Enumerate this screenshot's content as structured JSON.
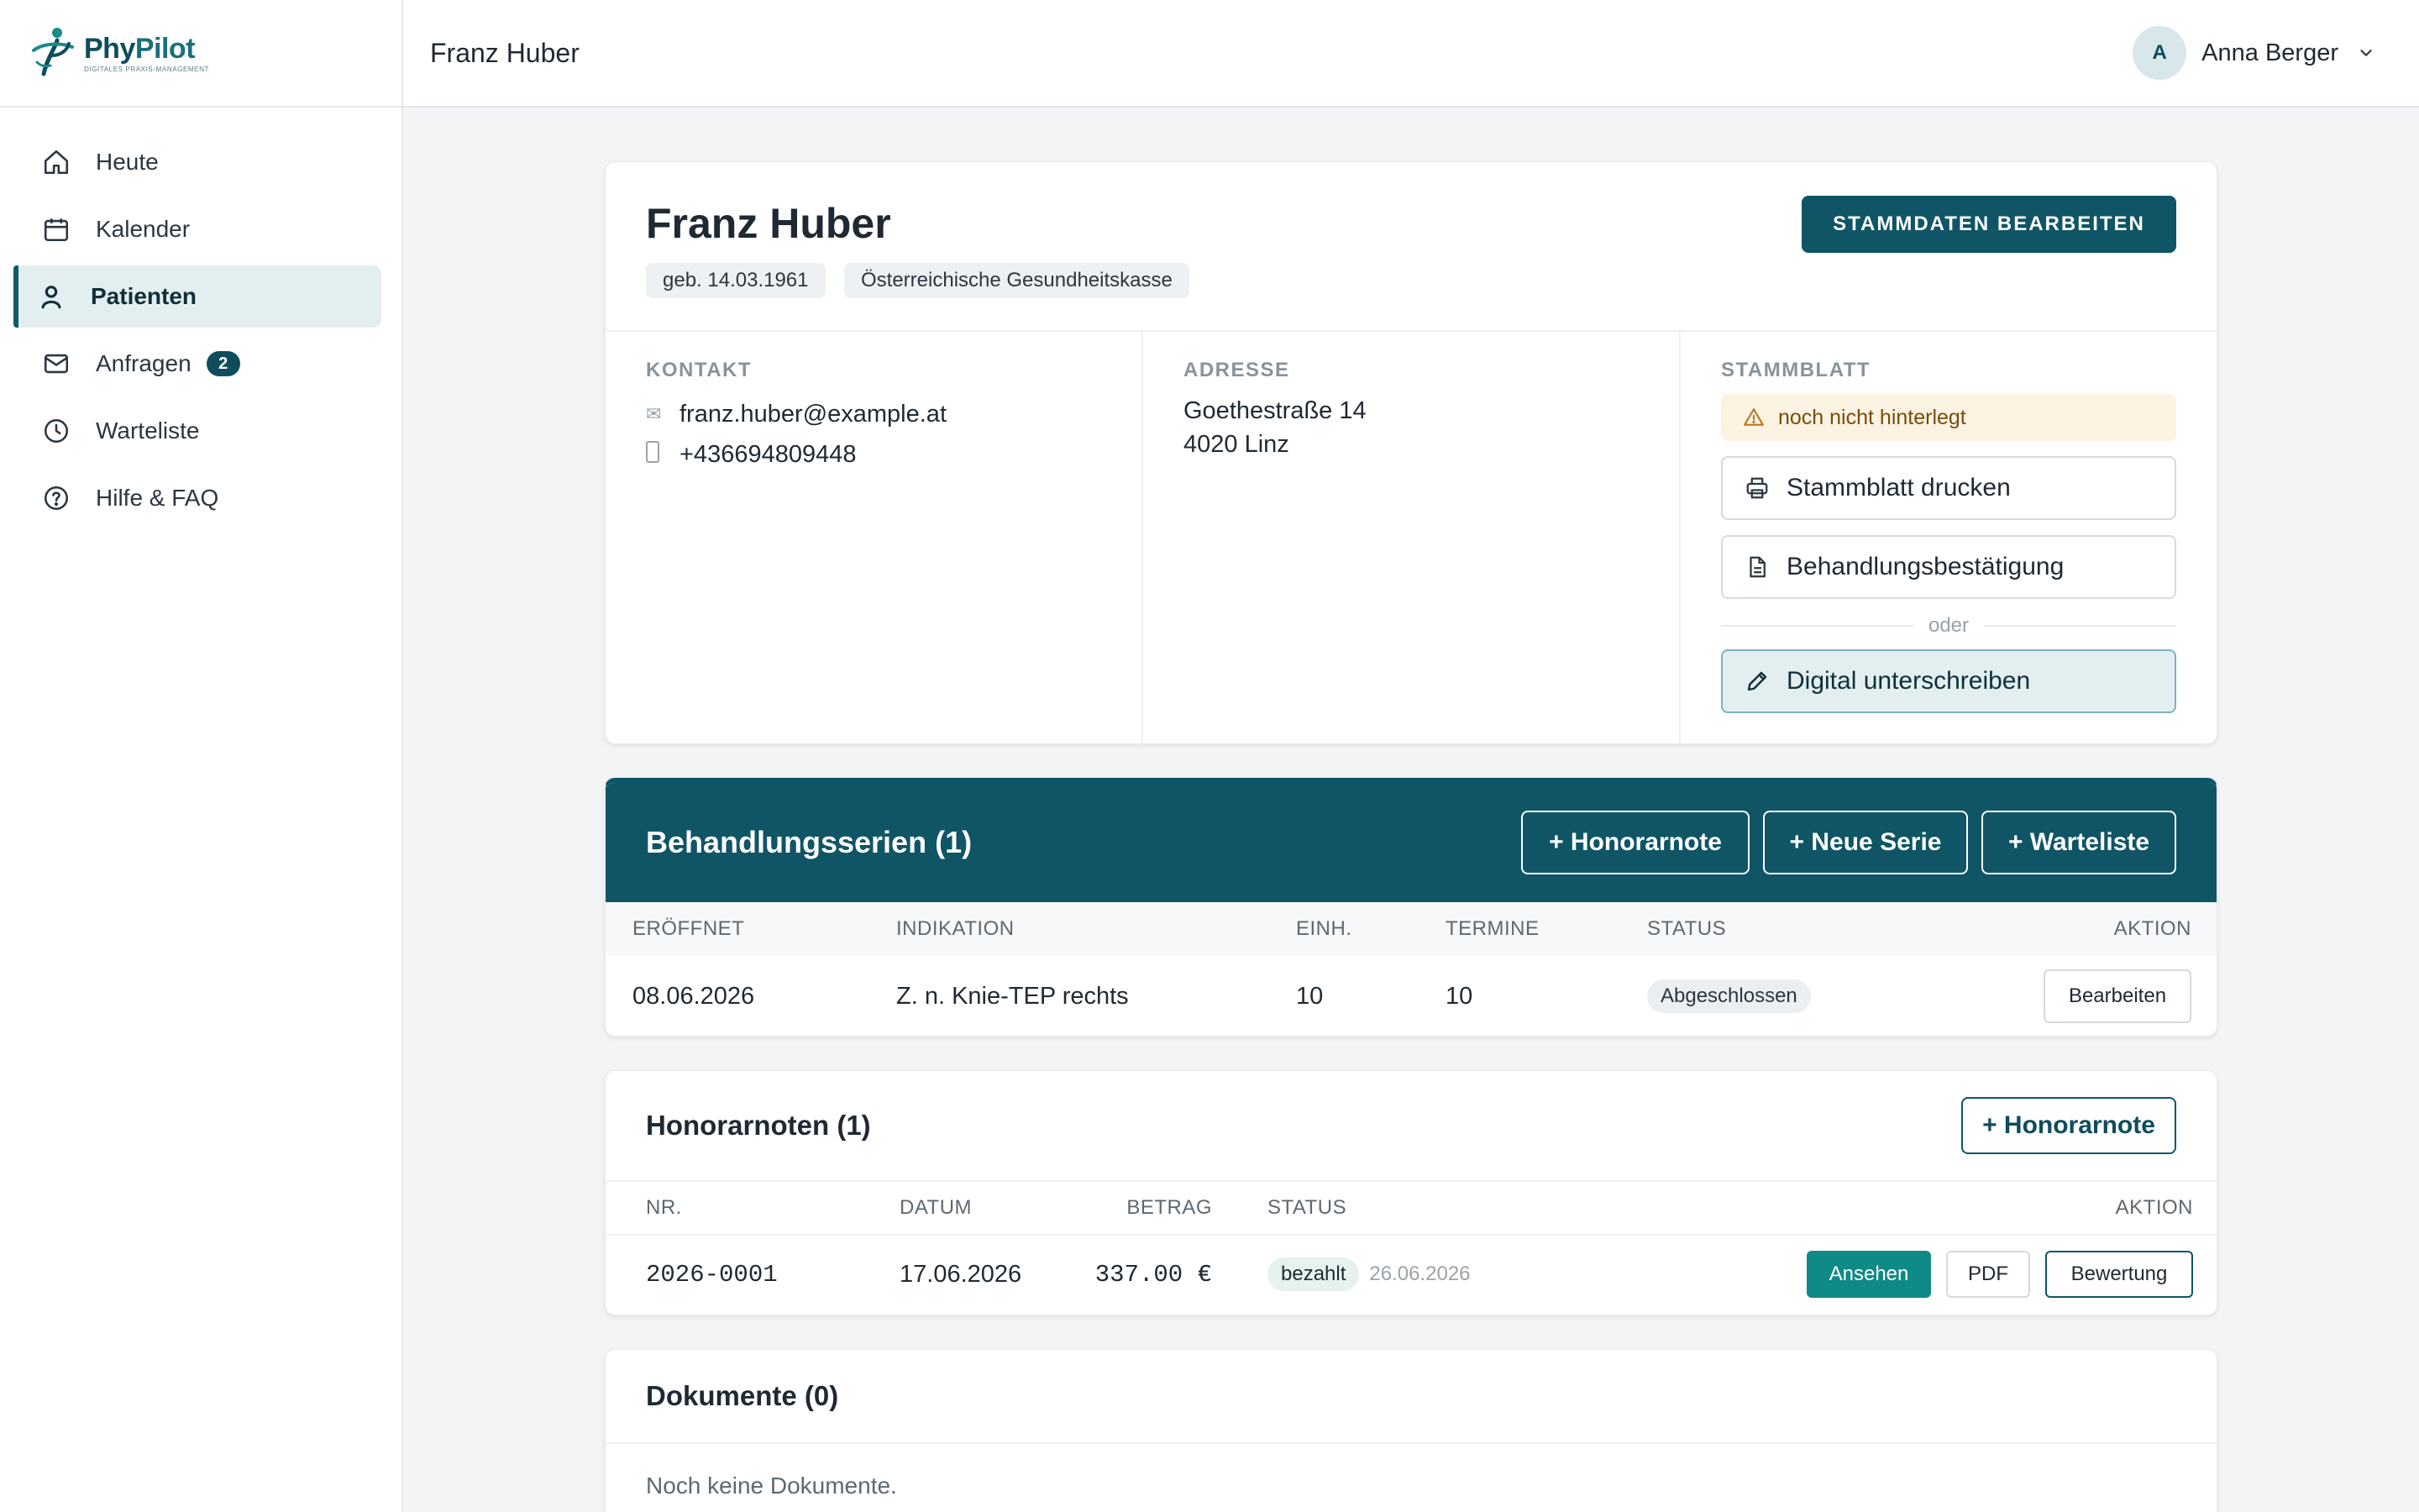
{
  "app": {
    "logo_name_part1": "Phy",
    "logo_name_part2": "Pilot",
    "logo_subtitle": "DIGITALES PRAXIS-MANAGEMENT",
    "brand_color": "#0f5566"
  },
  "sidebar": {
    "items": [
      {
        "label": "Heute",
        "icon": "home-icon",
        "active": false
      },
      {
        "label": "Kalender",
        "icon": "calendar-icon",
        "active": false
      },
      {
        "label": "Patienten",
        "icon": "person-icon",
        "active": true
      },
      {
        "label": "Anfragen",
        "icon": "mail-icon",
        "active": false,
        "badge": "2"
      },
      {
        "label": "Warteliste",
        "icon": "clock-icon",
        "active": false
      },
      {
        "label": "Hilfe & FAQ",
        "icon": "help-icon",
        "active": false
      }
    ]
  },
  "topbar": {
    "title": "Franz Huber",
    "user_initial": "A",
    "user_name": "Anna Berger"
  },
  "patient": {
    "name": "Franz Huber",
    "dob": "geb. 14.03.1961",
    "insurance": "Österreichische Gesundheitskasse",
    "edit_button": "STAMMDATEN BEARBEITEN",
    "contact_label": "KONTAKT",
    "email": "franz.huber@example.at",
    "phone": "+436694809448",
    "address_label": "ADRESSE",
    "address_line1": "Goethestraße 14",
    "address_line2": "4020 Linz",
    "stammblatt_label": "STAMMBLATT",
    "stammblatt_warning": "noch nicht hinterlegt",
    "print_button": "Stammblatt drucken",
    "confirm_button": "Behandlungsbestätigung",
    "or_text": "oder",
    "sign_button": "Digital unterschreiben"
  },
  "series": {
    "title": "Behandlungsserien (1)",
    "actions": [
      "+ Honorarnote",
      "+ Neue Serie",
      "+ Warteliste"
    ],
    "columns": [
      "ERÖFFNET",
      "INDIKATION",
      "EINH.",
      "TERMINE",
      "STATUS",
      "AKTION"
    ],
    "rows": [
      {
        "opened": "08.06.2026",
        "indication": "Z. n. Knie-TEP rechts",
        "units": "10",
        "appointments": "10",
        "status": "Abgeschlossen",
        "action": "Bearbeiten"
      }
    ]
  },
  "invoices": {
    "title": "Honorarnoten (1)",
    "add_button": "+ Honorarnote",
    "columns": [
      "NR.",
      "DATUM",
      "BETRAG",
      "STATUS",
      "AKTION"
    ],
    "rows": [
      {
        "nr": "2026-0001",
        "date": "17.06.2026",
        "amount": "337.00 €",
        "status": "bezahlt",
        "paid_date": "26.06.2026",
        "view": "Ansehen",
        "pdf": "PDF",
        "review": "Bewertung"
      }
    ]
  },
  "documents": {
    "title": "Dokumente (0)",
    "empty_text": "Noch keine Dokumente."
  }
}
